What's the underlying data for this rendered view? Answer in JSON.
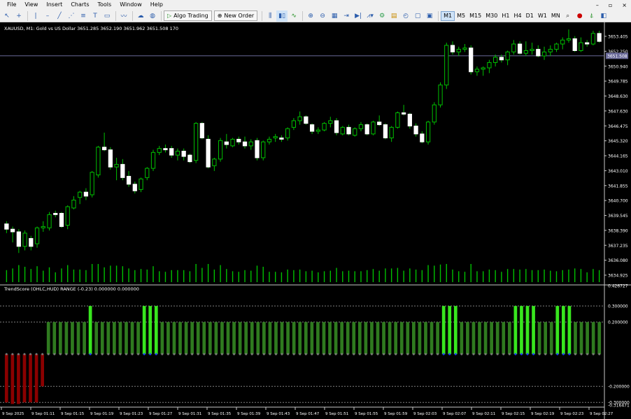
{
  "menu": [
    "File",
    "View",
    "Insert",
    "Charts",
    "Tools",
    "Window",
    "Help"
  ],
  "window_controls": [
    "–",
    "▫",
    "×"
  ],
  "toolbar": {
    "algo_trading": "Algo Trading",
    "new_order": "New Order",
    "timeframes": [
      "M1",
      "M5",
      "M15",
      "M30",
      "H1",
      "H4",
      "D1",
      "W1",
      "MN"
    ],
    "active_timeframe": "M1"
  },
  "chart": {
    "symbol_info": "XAUUSD, M1:  Gold vs US Dollar  3651.285 3652.190 3651.962 3651.508  170",
    "bid_label": "3651.508",
    "price_axis": [
      "3653.405",
      "3652.250",
      "3650.940",
      "3649.785",
      "3648.630",
      "3647.630",
      "3646.475",
      "3645.320",
      "3644.165",
      "3643.010",
      "3641.855",
      "3640.700",
      "3639.545",
      "3638.390",
      "3637.235",
      "3636.080",
      "3634.925"
    ],
    "indicator_title": "TrendScore (OHLC,HUD)  RANGE (-0.23) 0.000000 0.000000",
    "indicator_axis": [
      "0.426727",
      "0.300000",
      "0.200000",
      "-0.200000",
      "-0.300000",
      "-0.316471"
    ],
    "time_axis": [
      "9 Sep 2025",
      "9 Sep 01:11",
      "9 Sep 01:15",
      "9 Sep 01:19",
      "9 Sep 01:23",
      "9 Sep 01:27",
      "9 Sep 01:31",
      "9 Sep 01:35",
      "9 Sep 01:39",
      "9 Sep 01:43",
      "9 Sep 01:47",
      "9 Sep 01:51",
      "9 Sep 01:55",
      "9 Sep 01:59",
      "9 Sep 02:03",
      "9 Sep 02:07",
      "9 Sep 02:11",
      "9 Sep 02:15",
      "9 Sep 02:19",
      "9 Sep 02:23",
      "9 Sep 02:27"
    ],
    "colors": {
      "bull": "#00c000",
      "bear": "#ffffff",
      "wick": "#00c000",
      "grid": "#808080",
      "hist_pos": "#2f7a1f",
      "hist_strong": "#38e61e",
      "hist_neg": "#8b0000",
      "bid_line": "#6b6b9a"
    }
  },
  "chart_data": [
    {
      "type": "candlestick",
      "title": "XAUUSD, M1",
      "ylim": [
        3634.925,
        3653.405
      ],
      "candles_ohlc": [
        [
          3638.8,
          3639.0,
          3638.1,
          3638.4
        ],
        [
          3638.4,
          3638.6,
          3637.4,
          3638.2
        ],
        [
          3638.2,
          3638.4,
          3636.6,
          3637.1
        ],
        [
          3637.1,
          3638.3,
          3636.8,
          3638.1
        ],
        [
          3637.7,
          3637.9,
          3636.8,
          3637.1
        ],
        [
          3637.3,
          3638.6,
          3637.0,
          3638.5
        ],
        [
          3638.5,
          3639.0,
          3638.2,
          3638.6
        ],
        [
          3638.5,
          3639.7,
          3638.3,
          3639.5
        ],
        [
          3639.6,
          3639.8,
          3639.3,
          3639.5
        ],
        [
          3639.6,
          3639.7,
          3638.5,
          3638.6
        ],
        [
          3638.7,
          3640.2,
          3638.4,
          3640.1
        ],
        [
          3640.0,
          3640.9,
          3639.9,
          3640.6
        ],
        [
          3640.8,
          3641.3,
          3640.3,
          3641.2
        ],
        [
          3641.2,
          3641.5,
          3640.6,
          3640.9
        ],
        [
          3641.0,
          3642.8,
          3640.8,
          3642.7
        ],
        [
          3642.5,
          3644.7,
          3642.3,
          3644.6
        ],
        [
          3644.6,
          3645.7,
          3644.3,
          3644.4
        ],
        [
          3644.4,
          3644.6,
          3642.9,
          3643.1
        ],
        [
          3643.1,
          3643.8,
          3642.1,
          3643.3
        ],
        [
          3643.3,
          3643.7,
          3642.1,
          3642.3
        ],
        [
          3642.4,
          3642.8,
          3641.6,
          3641.8
        ],
        [
          3641.8,
          3642.0,
          3641.1,
          3641.3
        ],
        [
          3641.4,
          3642.3,
          3641.2,
          3642.2
        ],
        [
          3642.3,
          3643.1,
          3642.1,
          3643.0
        ],
        [
          3643.0,
          3644.4,
          3642.8,
          3644.2
        ],
        [
          3644.2,
          3644.7,
          3644.0,
          3644.5
        ],
        [
          3644.5,
          3644.8,
          3644.2,
          3644.4
        ],
        [
          3644.5,
          3644.7,
          3643.8,
          3644.0
        ],
        [
          3644.0,
          3644.5,
          3643.6,
          3644.3
        ],
        [
          3644.3,
          3644.5,
          3643.6,
          3643.9
        ],
        [
          3644.0,
          3644.1,
          3643.4,
          3643.5
        ],
        [
          3643.6,
          3646.5,
          3643.4,
          3646.4
        ],
        [
          3646.4,
          3646.5,
          3645.2,
          3645.3
        ],
        [
          3645.2,
          3645.5,
          3643.0,
          3643.1
        ],
        [
          3643.2,
          3643.8,
          3642.8,
          3643.7
        ],
        [
          3643.7,
          3645.3,
          3643.5,
          3645.1
        ],
        [
          3645.0,
          3645.6,
          3644.5,
          3644.8
        ],
        [
          3644.7,
          3645.3,
          3644.6,
          3645.2
        ],
        [
          3645.2,
          3645.4,
          3644.8,
          3645.0
        ],
        [
          3645.0,
          3645.4,
          3644.5,
          3644.7
        ],
        [
          3644.7,
          3645.2,
          3644.4,
          3645.0
        ],
        [
          3645.1,
          3645.3,
          3643.6,
          3643.8
        ],
        [
          3643.8,
          3645.1,
          3643.6,
          3645.0
        ],
        [
          3645.0,
          3645.4,
          3644.8,
          3645.2
        ],
        [
          3645.3,
          3645.6,
          3645.0,
          3645.4
        ],
        [
          3645.3,
          3645.5,
          3645.0,
          3645.2
        ],
        [
          3645.3,
          3646.1,
          3645.1,
          3646.0
        ],
        [
          3646.1,
          3646.8,
          3645.9,
          3646.6
        ],
        [
          3646.6,
          3647.3,
          3646.3,
          3646.9
        ],
        [
          3646.9,
          3647.0,
          3646.3,
          3646.4
        ],
        [
          3646.3,
          3646.4,
          3645.6,
          3645.8
        ],
        [
          3645.8,
          3646.1,
          3645.6,
          3645.9
        ],
        [
          3645.9,
          3646.5,
          3645.8,
          3646.4
        ],
        [
          3646.4,
          3646.9,
          3646.1,
          3646.6
        ],
        [
          3646.6,
          3646.8,
          3645.5,
          3645.7
        ],
        [
          3645.6,
          3646.2,
          3645.5,
          3646.1
        ],
        [
          3646.1,
          3646.3,
          3645.5,
          3645.6
        ],
        [
          3645.5,
          3646.1,
          3645.4,
          3646.0
        ],
        [
          3646.0,
          3646.5,
          3645.8,
          3646.3
        ],
        [
          3646.3,
          3646.4,
          3645.5,
          3645.6
        ],
        [
          3645.6,
          3646.6,
          3645.5,
          3646.5
        ],
        [
          3646.5,
          3647.0,
          3646.2,
          3646.3
        ],
        [
          3646.3,
          3646.4,
          3645.2,
          3645.3
        ],
        [
          3645.3,
          3646.2,
          3645.0,
          3646.1
        ],
        [
          3646.1,
          3647.3,
          3646.0,
          3647.2
        ],
        [
          3647.2,
          3647.8,
          3647.0,
          3647.1
        ],
        [
          3647.1,
          3647.2,
          3646.0,
          3646.2
        ],
        [
          3646.2,
          3646.4,
          3645.4,
          3645.6
        ],
        [
          3645.6,
          3645.8,
          3644.9,
          3645.0
        ],
        [
          3645.0,
          3646.6,
          3644.8,
          3646.5
        ],
        [
          3646.5,
          3648.0,
          3646.3,
          3647.8
        ],
        [
          3647.8,
          3649.5,
          3647.6,
          3649.3
        ],
        [
          3649.3,
          3652.5,
          3649.0,
          3652.3
        ],
        [
          3652.3,
          3652.6,
          3651.6,
          3651.8
        ],
        [
          3651.8,
          3652.2,
          3651.5,
          3652.0
        ],
        [
          3652.0,
          3652.4,
          3651.8,
          3652.1
        ],
        [
          3652.1,
          3652.3,
          3650.1,
          3650.3
        ],
        [
          3650.3,
          3650.7,
          3650.0,
          3650.5
        ],
        [
          3650.5,
          3650.7,
          3650.0,
          3650.6
        ],
        [
          3650.6,
          3651.2,
          3650.2,
          3651.0
        ],
        [
          3651.0,
          3651.6,
          3650.7,
          3651.4
        ],
        [
          3651.4,
          3651.6,
          3651.0,
          3651.2
        ],
        [
          3651.2,
          3651.9,
          3650.8,
          3651.8
        ],
        [
          3651.8,
          3652.7,
          3651.6,
          3652.4
        ],
        [
          3652.4,
          3652.6,
          3651.6,
          3651.7
        ],
        [
          3651.7,
          3652.6,
          3651.5,
          3651.9
        ],
        [
          3651.9,
          3652.5,
          3651.6,
          3652.0
        ],
        [
          3652.0,
          3652.3,
          3651.4,
          3651.5
        ],
        [
          3651.5,
          3652.2,
          3651.2,
          3651.8
        ],
        [
          3651.8,
          3652.3,
          3651.5,
          3652.0
        ],
        [
          3652.0,
          3652.5,
          3651.8,
          3652.4
        ],
        [
          3652.4,
          3652.9,
          3652.0,
          3652.7
        ],
        [
          3652.7,
          3653.5,
          3652.5,
          3652.8
        ],
        [
          3652.8,
          3653.0,
          3651.8,
          3651.9
        ],
        [
          3651.9,
          3652.9,
          3651.8,
          3652.5
        ],
        [
          3652.5,
          3652.7,
          3652.2,
          3652.4
        ],
        [
          3652.4,
          3653.4,
          3652.3,
          3653.2
        ],
        [
          3653.2,
          3653.4,
          3652.5,
          3652.6
        ]
      ]
    },
    {
      "type": "bar",
      "title": "TrendScore (OHLC,HUD)",
      "ylim": [
        -0.316471,
        0.426727
      ],
      "values": [
        -0.3,
        -0.31,
        -0.31,
        -0.3,
        -0.3,
        -0.3,
        -0.2,
        0.2,
        0.2,
        0.2,
        0.2,
        0.2,
        0.2,
        0.2,
        0.3,
        0.2,
        0.2,
        0.2,
        0.2,
        0.2,
        0.2,
        0.2,
        0.2,
        0.3,
        0.3,
        0.3,
        0.2,
        0.2,
        0.2,
        0.2,
        0.2,
        0.2,
        0.2,
        0.2,
        0.2,
        0.2,
        0.2,
        0.2,
        0.2,
        0.2,
        0.2,
        0.2,
        0.2,
        0.2,
        0.2,
        0.2,
        0.2,
        0.2,
        0.2,
        0.2,
        0.2,
        0.2,
        0.2,
        0.2,
        0.2,
        0.2,
        0.2,
        0.2,
        0.2,
        0.2,
        0.2,
        0.2,
        0.2,
        0.2,
        0.2,
        0.2,
        0.2,
        0.2,
        0.2,
        0.2,
        0.2,
        0.2,
        0.2,
        0.3,
        0.3,
        0.3,
        0.2,
        0.2,
        0.2,
        0.2,
        0.2,
        0.2,
        0.2,
        0.2,
        0.2,
        0.3,
        0.3,
        0.3,
        0.3,
        0.2,
        0.2,
        0.2,
        0.3,
        0.3,
        0.3,
        0.2,
        0.2,
        0.2,
        0.2,
        0.2
      ]
    }
  ]
}
